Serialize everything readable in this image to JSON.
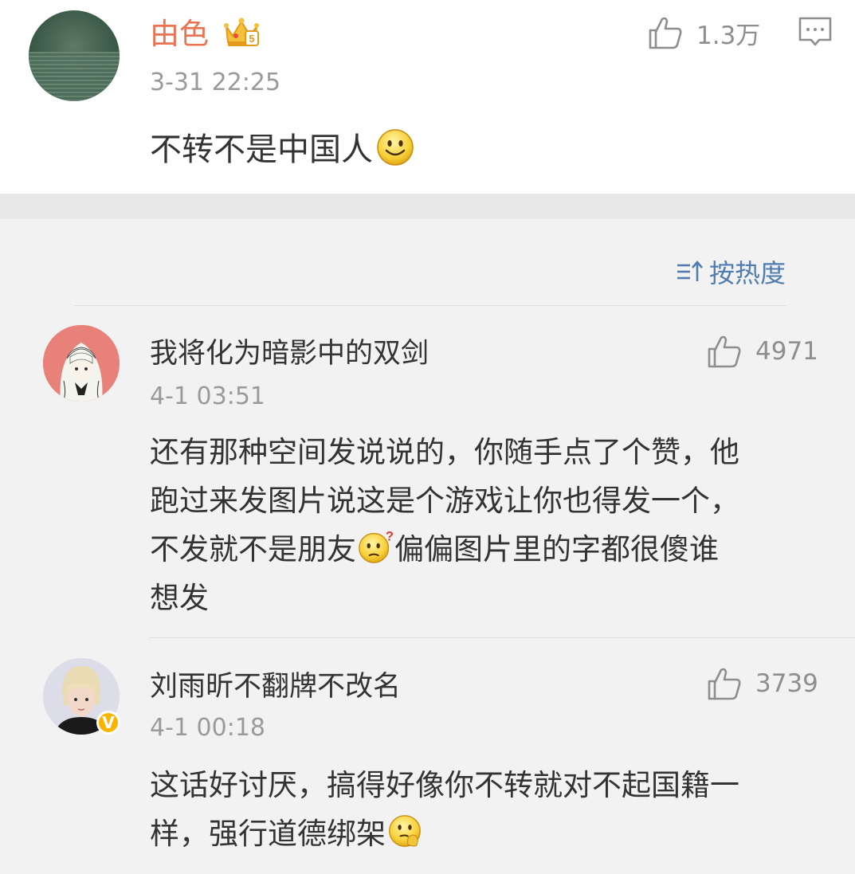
{
  "post": {
    "author": "由色",
    "vip_level": "5",
    "time": "3-31 22:25",
    "content": "不转不是中国人",
    "content_emoji": "smile-emoji",
    "likes": "1.3万",
    "colors": {
      "author": "#eb7350",
      "accent": "#507daf",
      "meta": "#9a9a9a"
    }
  },
  "sort": {
    "label": "按热度",
    "icon": "sort-icon"
  },
  "comments": [
    {
      "author": "我将化为暗影中的双剑",
      "time": "4-1 03:51",
      "likes": "4971",
      "lines": [
        "还有那种空间发说说的，你随手点了个赞，他",
        "跑过来发图片说这是个游戏让你也得发一个，",
        "不发就不是朋友",
        "偏偏图片里的字都很傻谁",
        "想发"
      ],
      "emoji": "confused-emoji"
    },
    {
      "author": "刘雨昕不翻牌不改名",
      "time": "4-1 00:18",
      "likes": "3739",
      "verified_badge": "V",
      "lines": [
        "这话好讨厌，搞得好像你不转就对不起国籍一",
        "样，强行道德绑架"
      ],
      "emoji": "thinking-emoji"
    }
  ]
}
